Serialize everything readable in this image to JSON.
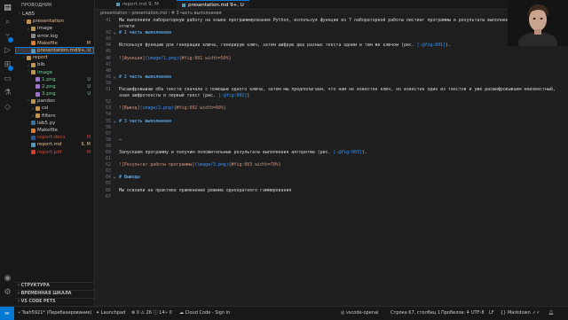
{
  "sidebar": {
    "title": "ПРОВОДНИК",
    "items": [
      {
        "depth": 0,
        "arrow": "˅",
        "label": "LAB5",
        "icon": "",
        "status": "",
        "badge": "",
        "selected": false
      },
      {
        "depth": 1,
        "arrow": "˅",
        "label": "presentation",
        "icon": "folder",
        "status": "mod",
        "badge": "",
        "selected": false
      },
      {
        "depth": 2,
        "arrow": "›",
        "label": "image",
        "icon": "folder",
        "status": "",
        "badge": "",
        "selected": false
      },
      {
        "depth": 2,
        "arrow": "",
        "label": "error.log",
        "icon": "log",
        "status": "",
        "badge": "",
        "selected": false
      },
      {
        "depth": 2,
        "arrow": "",
        "label": "Makefile",
        "icon": "make",
        "status": "mod",
        "badge": "M",
        "selected": false
      },
      {
        "depth": 2,
        "arrow": "",
        "label": "presentation.md",
        "icon": "md",
        "status": "mod",
        "badge": "9+, U",
        "selected": true
      },
      {
        "depth": 1,
        "arrow": "˅",
        "label": "report",
        "icon": "folder",
        "status": "mod",
        "badge": "",
        "selected": false
      },
      {
        "depth": 2,
        "arrow": "›",
        "label": "bib",
        "icon": "folder",
        "status": "",
        "badge": "",
        "selected": false
      },
      {
        "depth": 2,
        "arrow": "˅",
        "label": "image",
        "icon": "folder",
        "status": "unt",
        "badge": "",
        "selected": false
      },
      {
        "depth": 3,
        "arrow": "",
        "label": "1.png",
        "icon": "img",
        "status": "unt",
        "badge": "U",
        "selected": false
      },
      {
        "depth": 3,
        "arrow": "",
        "label": "2.png",
        "icon": "img",
        "status": "unt",
        "badge": "U",
        "selected": false
      },
      {
        "depth": 3,
        "arrow": "",
        "label": "3.png",
        "icon": "img",
        "status": "unt",
        "badge": "U",
        "selected": false
      },
      {
        "depth": 2,
        "arrow": "˅",
        "label": "pandoc",
        "icon": "folder",
        "status": "",
        "badge": "",
        "selected": false
      },
      {
        "depth": 3,
        "arrow": "›",
        "label": "csl",
        "icon": "folder",
        "status": "",
        "badge": "",
        "selected": false
      },
      {
        "depth": 3,
        "arrow": "›",
        "label": "filters",
        "icon": "folder",
        "status": "",
        "badge": "",
        "selected": false
      },
      {
        "depth": 2,
        "arrow": "",
        "label": "lab5.py",
        "icon": "py",
        "status": "",
        "badge": "",
        "selected": false
      },
      {
        "depth": 2,
        "arrow": "",
        "label": "Makefile",
        "icon": "make",
        "status": "",
        "badge": "",
        "selected": false
      },
      {
        "depth": 2,
        "arrow": "",
        "label": "report.docx",
        "icon": "doc",
        "status": "del",
        "badge": "M",
        "selected": false
      },
      {
        "depth": 2,
        "arrow": "",
        "label": "report.md",
        "icon": "md",
        "status": "mod",
        "badge": "9, M",
        "selected": false
      },
      {
        "depth": 2,
        "arrow": "",
        "label": "report.pdf",
        "icon": "pdf",
        "status": "del",
        "badge": "M",
        "selected": false
      }
    ],
    "sections": [
      "СТРУКТУРА",
      "ВРЕМЕННАЯ ШКАЛА",
      "VS CODE PETS"
    ]
  },
  "tabs": [
    {
      "label": "report.md 9, M",
      "active": false
    },
    {
      "label": "presentation.md 9+, U",
      "active": true
    }
  ],
  "breadcrumbs": "presentation › presentation.md › # 3 часть выполнения",
  "code_lines": [
    {
      "n": "41",
      "fold": "",
      "segments": [
        {
          "t": "Мы выполнили лабораторную работу на языке программирования Python, используя функции из 7 лабораторной работы листинг программы и результаты выполнения в",
          "c": ""
        }
      ]
    },
    {
      "n": "",
      "fold": "",
      "segments": [
        {
          "t": "отчете",
          "c": ""
        }
      ]
    },
    {
      "n": "42",
      "fold": "˅",
      "segments": [
        {
          "t": "# 1 часть выполнения",
          "c": "heading"
        }
      ]
    },
    {
      "n": "43",
      "fold": "",
      "segments": []
    },
    {
      "n": "44",
      "fold": "",
      "segments": [
        {
          "t": "Используя функцию для генерации ключа, генерирую ключ, затем шифрую два разных текста одним и тем же ключом (рис. ",
          "c": ""
        },
        {
          "t": "[-@fig:001]",
          "c": "ref"
        },
        {
          "t": ").",
          "c": ""
        }
      ]
    },
    {
      "n": "45",
      "fold": "",
      "segments": []
    },
    {
      "n": "46",
      "fold": "",
      "segments": [
        {
          "t": "![Функции]",
          "c": "link"
        },
        {
          "t": "(image/1.png)",
          "c": "ref"
        },
        {
          "t": "{#fig:001 width=50%}",
          "c": "link"
        }
      ]
    },
    {
      "n": "47",
      "fold": "",
      "segments": []
    },
    {
      "n": "48",
      "fold": "",
      "segments": []
    },
    {
      "n": "49",
      "fold": "˅",
      "segments": [
        {
          "t": "# 2 часть выполнения",
          "c": "heading"
        }
      ]
    },
    {
      "n": "50",
      "fold": "",
      "segments": []
    },
    {
      "n": "51",
      "fold": "",
      "segments": [
        {
          "t": "Расшифровываю оба текста сначала с помощью одного ключа, затем мы предполагаем, что нам не известен ключ, но известен один из текстов и уже расшифровываем неизвестный,",
          "c": ""
        }
      ]
    },
    {
      "n": "",
      "fold": "",
      "segments": [
        {
          "t": "зная шифротексты и первый текст  (рис. ",
          "c": ""
        },
        {
          "t": "[-@fig:002]",
          "c": "ref"
        },
        {
          "t": ")",
          "c": ""
        }
      ]
    },
    {
      "n": "52",
      "fold": "",
      "segments": []
    },
    {
      "n": "53",
      "fold": "",
      "segments": [
        {
          "t": "![Вывод]",
          "c": "link"
        },
        {
          "t": "(image/2.png)",
          "c": "ref"
        },
        {
          "t": "{#fig:002 width=60%}",
          "c": "link"
        }
      ]
    },
    {
      "n": "54",
      "fold": "",
      "segments": []
    },
    {
      "n": "55",
      "fold": "˅",
      "segments": [
        {
          "t": "# 3 часть выполнения",
          "c": "heading"
        }
      ]
    },
    {
      "n": "56",
      "fold": "",
      "segments": []
    },
    {
      "n": "57",
      "fold": "",
      "segments": []
    },
    {
      "n": "58",
      "fold": "",
      "segments": [
        {
          "t": "—",
          "c": ""
        }
      ]
    },
    {
      "n": "59",
      "fold": "",
      "segments": []
    },
    {
      "n": "60",
      "fold": "",
      "segments": [
        {
          "t": "Запускаем программу и получим положительные результаты выполнения алгоритма (рис. ",
          "c": ""
        },
        {
          "t": "[-@fig:003]",
          "c": "ref"
        },
        {
          "t": ").",
          "c": ""
        }
      ]
    },
    {
      "n": "61",
      "fold": "",
      "segments": []
    },
    {
      "n": "62",
      "fold": "",
      "segments": [
        {
          "t": "![Результат работы программы]",
          "c": "link"
        },
        {
          "t": "(image/3.png)",
          "c": "ref"
        },
        {
          "t": "{#fig:003 width=70%}",
          "c": "link"
        }
      ]
    },
    {
      "n": "63",
      "fold": "",
      "segments": []
    },
    {
      "n": "64",
      "fold": "˅",
      "segments": [
        {
          "t": "# Выводы",
          "c": "heading"
        }
      ]
    },
    {
      "n": "65",
      "fold": "",
      "segments": []
    },
    {
      "n": "66",
      "fold": "",
      "segments": [
        {
          "t": "Мы освоили на практике применение режима однократного гаммирования",
          "c": ""
        }
      ]
    },
    {
      "n": "67",
      "fold": "",
      "segments": []
    }
  ],
  "statusbar": {
    "branch": "Tsah5921* (Перебазирование)",
    "launchpad": "Launchpad",
    "problems": "⊗ 0 ⚠ 26 ⓘ 14",
    "ports": "⑂ 0",
    "cloud": "Cloud Code - Sign in",
    "profile": "vscode-openai",
    "position": "Строка 67, столбец 1",
    "spaces": "Пробелов: 4",
    "encoding": "UTF-8",
    "eol": "LF",
    "language": "Markdown"
  },
  "colors": {
    "accent": "#0078d4",
    "modified": "#e2c08d",
    "untracked": "#73c991",
    "deleted": "#c74e39",
    "heading": "#569cd6"
  }
}
